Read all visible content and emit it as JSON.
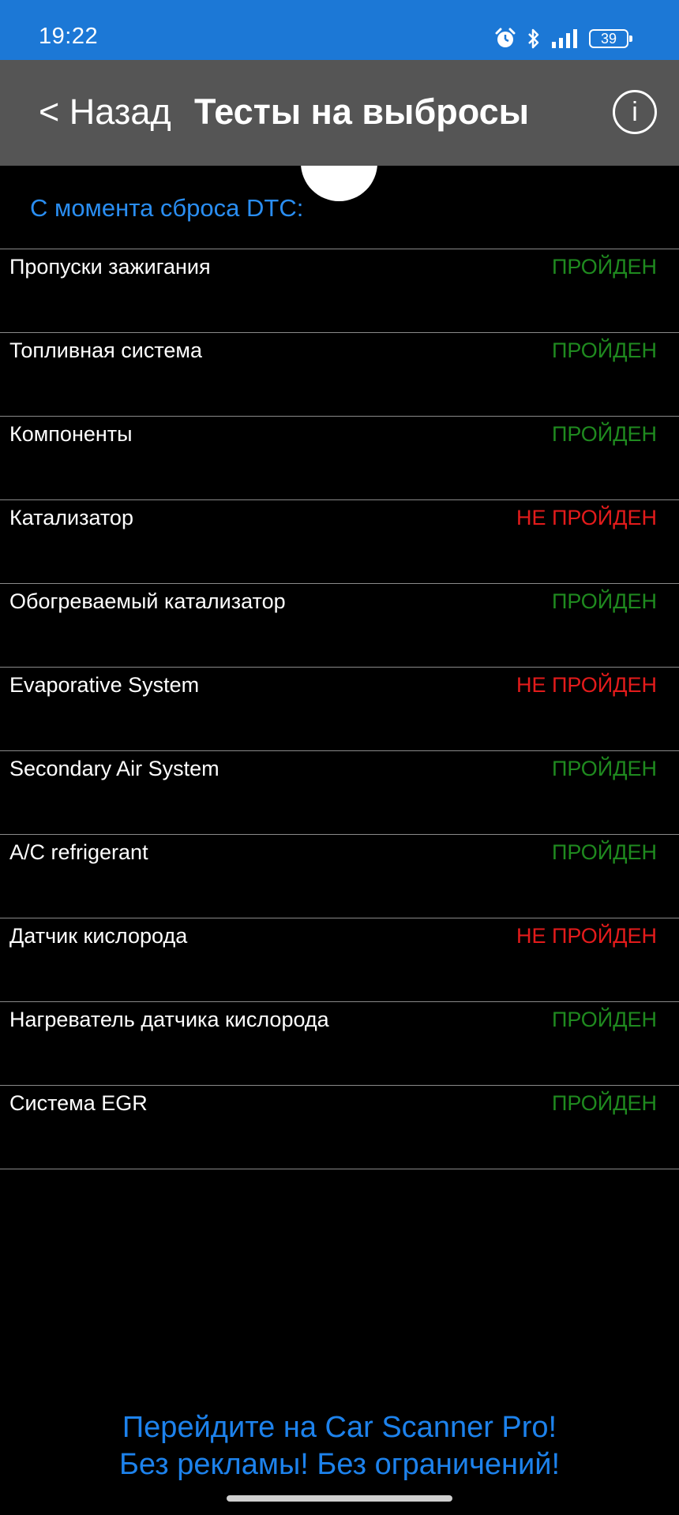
{
  "status_bar": {
    "time": "19:22",
    "battery": "39",
    "icons": [
      "alarm-icon",
      "bluetooth-icon",
      "signal-icon",
      "battery-icon"
    ]
  },
  "header": {
    "back_label": "< Назад",
    "title": "Тесты на выбросы",
    "info_label": "i"
  },
  "section": {
    "title": "С момента сброса DTC:"
  },
  "tests": [
    {
      "name": "Пропуски зажигания",
      "status": "ПРОЙДЕН",
      "passed": true
    },
    {
      "name": "Топливная система",
      "status": "ПРОЙДЕН",
      "passed": true
    },
    {
      "name": "Компоненты",
      "status": "ПРОЙДЕН",
      "passed": true
    },
    {
      "name": "Катализатор",
      "status": "НЕ ПРОЙДЕН",
      "passed": false
    },
    {
      "name": "Обогреваемый катализатор",
      "status": "ПРОЙДЕН",
      "passed": true
    },
    {
      "name": "Evaporative System",
      "status": "НЕ ПРОЙДЕН",
      "passed": false
    },
    {
      "name": "Secondary Air System",
      "status": "ПРОЙДЕН",
      "passed": true
    },
    {
      "name": "A/C refrigerant",
      "status": "ПРОЙДЕН",
      "passed": true
    },
    {
      "name": "Датчик кислорода",
      "status": "НЕ ПРОЙДЕН",
      "passed": false
    },
    {
      "name": "Нагреватель датчика кислорода",
      "status": "ПРОЙДЕН",
      "passed": true
    },
    {
      "name": "Система EGR",
      "status": "ПРОЙДЕН",
      "passed": true
    }
  ],
  "promo": {
    "line1": "Перейдите на Car Scanner Pro!",
    "line2": "Без рекламы! Без ограничений!"
  },
  "colors": {
    "status_bar": "#1c78d6",
    "header": "#555555",
    "accent": "#2a8ef2",
    "pass": "#1f8a1f",
    "fail": "#e31b1b"
  }
}
